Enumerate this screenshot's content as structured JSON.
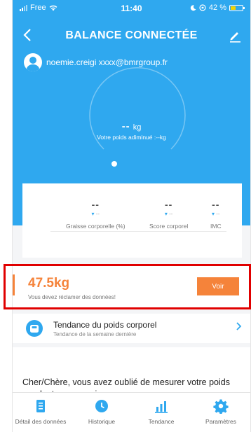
{
  "status_bar": {
    "carrier": "Free",
    "time": "11:40",
    "battery": "42 %"
  },
  "header": {
    "title": "BALANCE CONNECTÉE",
    "back_icon": "chevron-left-icon",
    "edit_icon": "pencil-icon"
  },
  "user": {
    "email": "noemie.creigi xxxx@bmrgroup.fr"
  },
  "gauge": {
    "value": "--",
    "unit": "kg",
    "subtitle": "Votre poids adiminué :--kg"
  },
  "stats": [
    {
      "value": "--",
      "delta": "--",
      "label": "Graisse corporelle (%)"
    },
    {
      "value": "--",
      "delta": "--",
      "label": "Score corporel"
    },
    {
      "value": "--",
      "delta": "--",
      "label": "IMC"
    }
  ],
  "claim": {
    "weight": "47.5kg",
    "message": "Vous devez réclamer des données!",
    "button": "Voir"
  },
  "trend": {
    "title": "Tendance du poids corporel",
    "subtitle": "Tendance de la semaine dernière"
  },
  "reminder": {
    "text": "Cher/Chère, vous avez oublié de mesurer votre poids pendant une semaine."
  },
  "tabs": [
    {
      "label": "Détail des données",
      "icon": "document-icon"
    },
    {
      "label": "Historique",
      "icon": "clock-icon"
    },
    {
      "label": "Tendance",
      "icon": "bar-chart-icon"
    },
    {
      "label": "Paramètres",
      "icon": "gear-icon"
    }
  ],
  "colors": {
    "primary": "#2fa8ef",
    "accent": "#f5833a",
    "highlight_border": "#e00000"
  }
}
